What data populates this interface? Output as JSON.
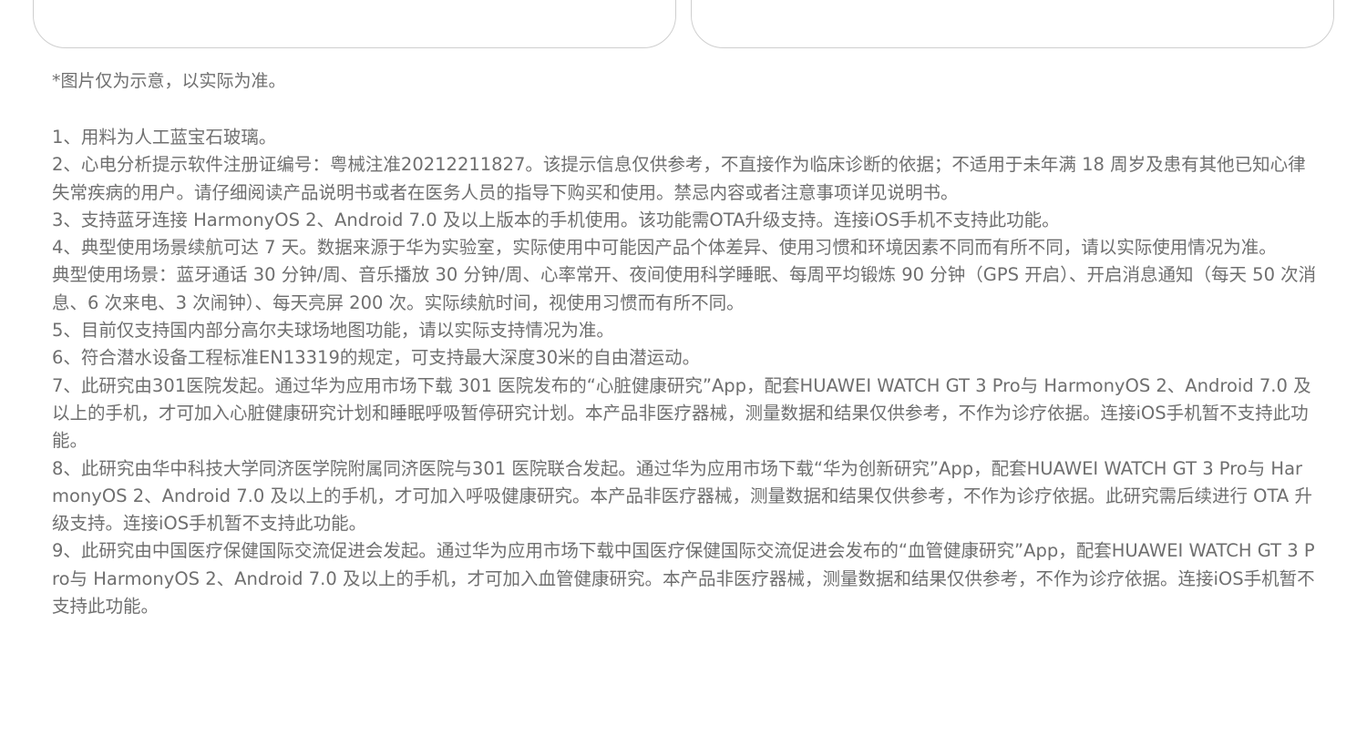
{
  "disclaimer": "*图片仅为示意，以实际为准。",
  "notes": [
    "1、用料为人工蓝宝石玻璃。",
    "2、心电分析提示软件注册证编号：粤械注准20212211827。该提示信息仅供参考，不直接作为临床诊断的依据；不适用于未年满 18 周岁及患有其他已知心律失常疾病的用户。请仔细阅读产品说明书或者在医务人员的指导下购买和使用。禁忌内容或者注意事项详见说明书。",
    "3、支持蓝牙连接 HarmonyOS 2、Android 7.0 及以上版本的手机使用。该功能需OTA升级支持。连接iOS手机不支持此功能。",
    "4、典型使用场景续航可达 7 天。数据来源于华为实验室，实际使用中可能因产品个体差异、使用习惯和环境因素不同而有所不同，请以实际使用情况为准。",
    "典型使用场景：蓝牙通话 30 分钟/周、音乐播放 30 分钟/周、心率常开、夜间使用科学睡眠、每周平均锻炼 90 分钟（GPS 开启）、开启消息通知（每天 50 次消息、6 次来电、3 次闹钟）、每天亮屏 200 次。实际续航时间，视使用习惯而有所不同。",
    "5、目前仅支持国内部分高尔夫球场地图功能，请以实际支持情况为准。",
    "6、符合潜水设备工程标准EN13319的规定，可支持最大深度30米的自由潜运动。",
    "7、此研究由301医院发起。通过华为应用市场下载 301 医院发布的“心脏健康研究”App，配套HUAWEI WATCH GT 3 Pro与 HarmonyOS 2、Android 7.0 及以上的手机，才可加入心脏健康研究计划和睡眠呼吸暂停研究计划。本产品非医疗器械，测量数据和结果仅供参考，不作为诊疗依据。连接iOS手机暂不支持此功能。",
    "8、此研究由华中科技大学同济医学院附属同济医院与301 医院联合发起。通过华为应用市场下载“华为创新研究”App，配套HUAWEI WATCH GT 3 Pro与 HarmonyOS 2、Android 7.0 及以上的手机，才可加入呼吸健康研究。本产品非医疗器械，测量数据和结果仅供参考，不作为诊疗依据。此研究需后续进行 OTA 升级支持。连接iOS手机暂不支持此功能。",
    "9、此研究由中国医疗保健国际交流促进会发起。通过华为应用市场下载中国医疗保健国际交流促进会发布的“血管健康研究”App，配套HUAWEI WATCH GT 3 Pro与 HarmonyOS 2、Android 7.0 及以上的手机，才可加入血管健康研究。本产品非医疗器械，测量数据和结果仅供参考，不作为诊疗依据。连接iOS手机暂不支持此功能。"
  ]
}
